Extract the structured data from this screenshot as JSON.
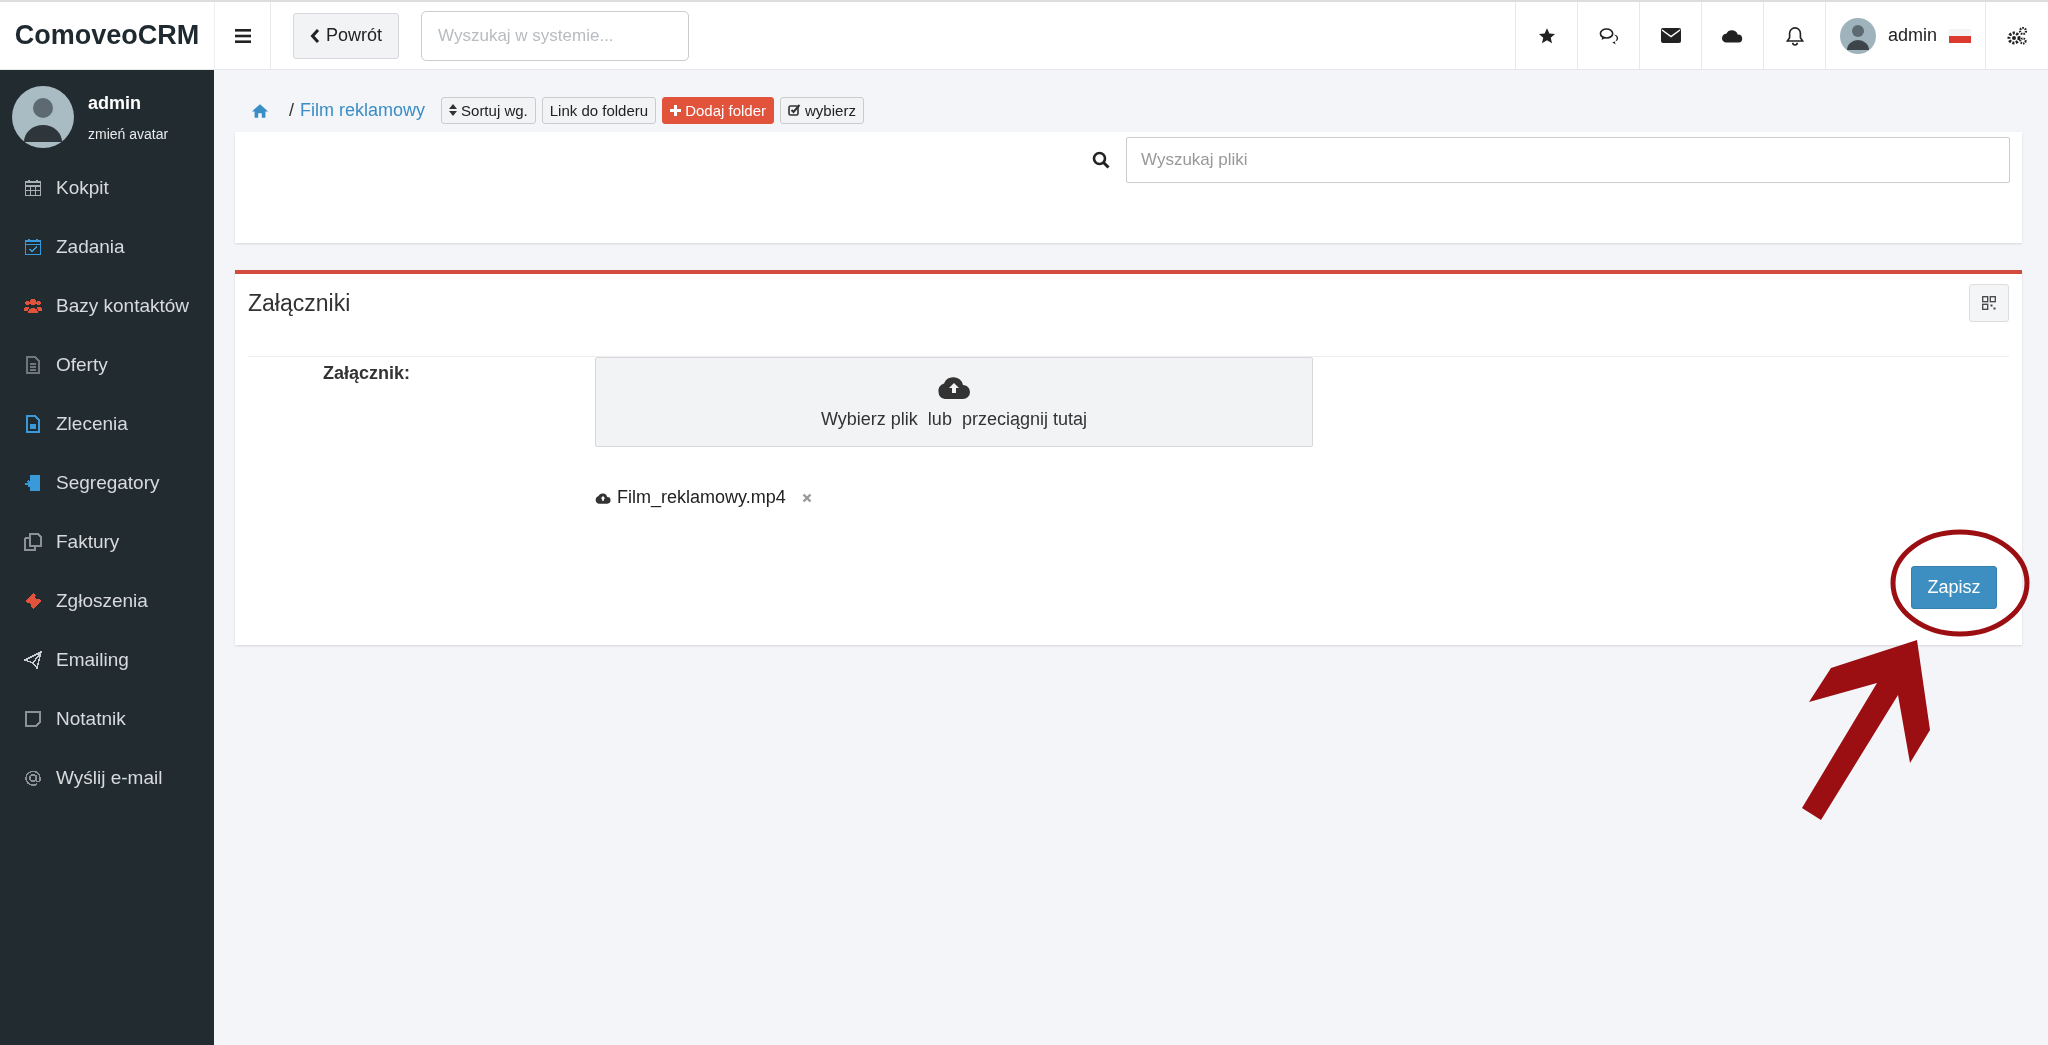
{
  "brand": "ComoveoCRM",
  "topbar": {
    "back_button": "Powrót",
    "search": {
      "placeholder": "Wyszukaj w systemie..."
    },
    "user": "admin"
  },
  "sidebar": {
    "user": {
      "name": "admin",
      "link": "zmień avatar"
    },
    "items": [
      {
        "label": "Kokpit",
        "color": "#a8b0b5"
      },
      {
        "label": "Zadania",
        "color": "#3a9ad9"
      },
      {
        "label": "Bazy kontaktów",
        "color": "#e2533c"
      },
      {
        "label": "Oferty",
        "color": "#6f777c"
      },
      {
        "label": "Zlecenia",
        "color": "#3a9ad9"
      },
      {
        "label": "Segregatory",
        "color": "#3a9ad9"
      },
      {
        "label": "Faktury",
        "color": "#8a9296"
      },
      {
        "label": "Zgłoszenia",
        "color": "#e2533c"
      },
      {
        "label": "Emailing",
        "color": "#c9ced1"
      },
      {
        "label": "Notatnik",
        "color": "#8a9296"
      },
      {
        "label": "Wyślij e-mail",
        "color": "#8a9296"
      }
    ]
  },
  "breadcrumb": {
    "separator": "/",
    "folder": "Film reklamowy",
    "buttons": [
      {
        "label": "Sortuj wg.",
        "kind": "sort"
      },
      {
        "label": "Link do folderu",
        "kind": "plain"
      },
      {
        "label": "Dodaj folder",
        "kind": "add"
      },
      {
        "label": "wybierz",
        "kind": "select"
      }
    ]
  },
  "file_search": {
    "placeholder": "Wyszukaj pliki"
  },
  "attachments": {
    "title": "Załączniki",
    "field_label": "Załącznik:",
    "dropzone": "Wybierz plik  lub  przeciągnij tutaj",
    "files": [
      {
        "name": "Film_reklamowy.mp4"
      }
    ],
    "save_button": "Zapisz"
  }
}
